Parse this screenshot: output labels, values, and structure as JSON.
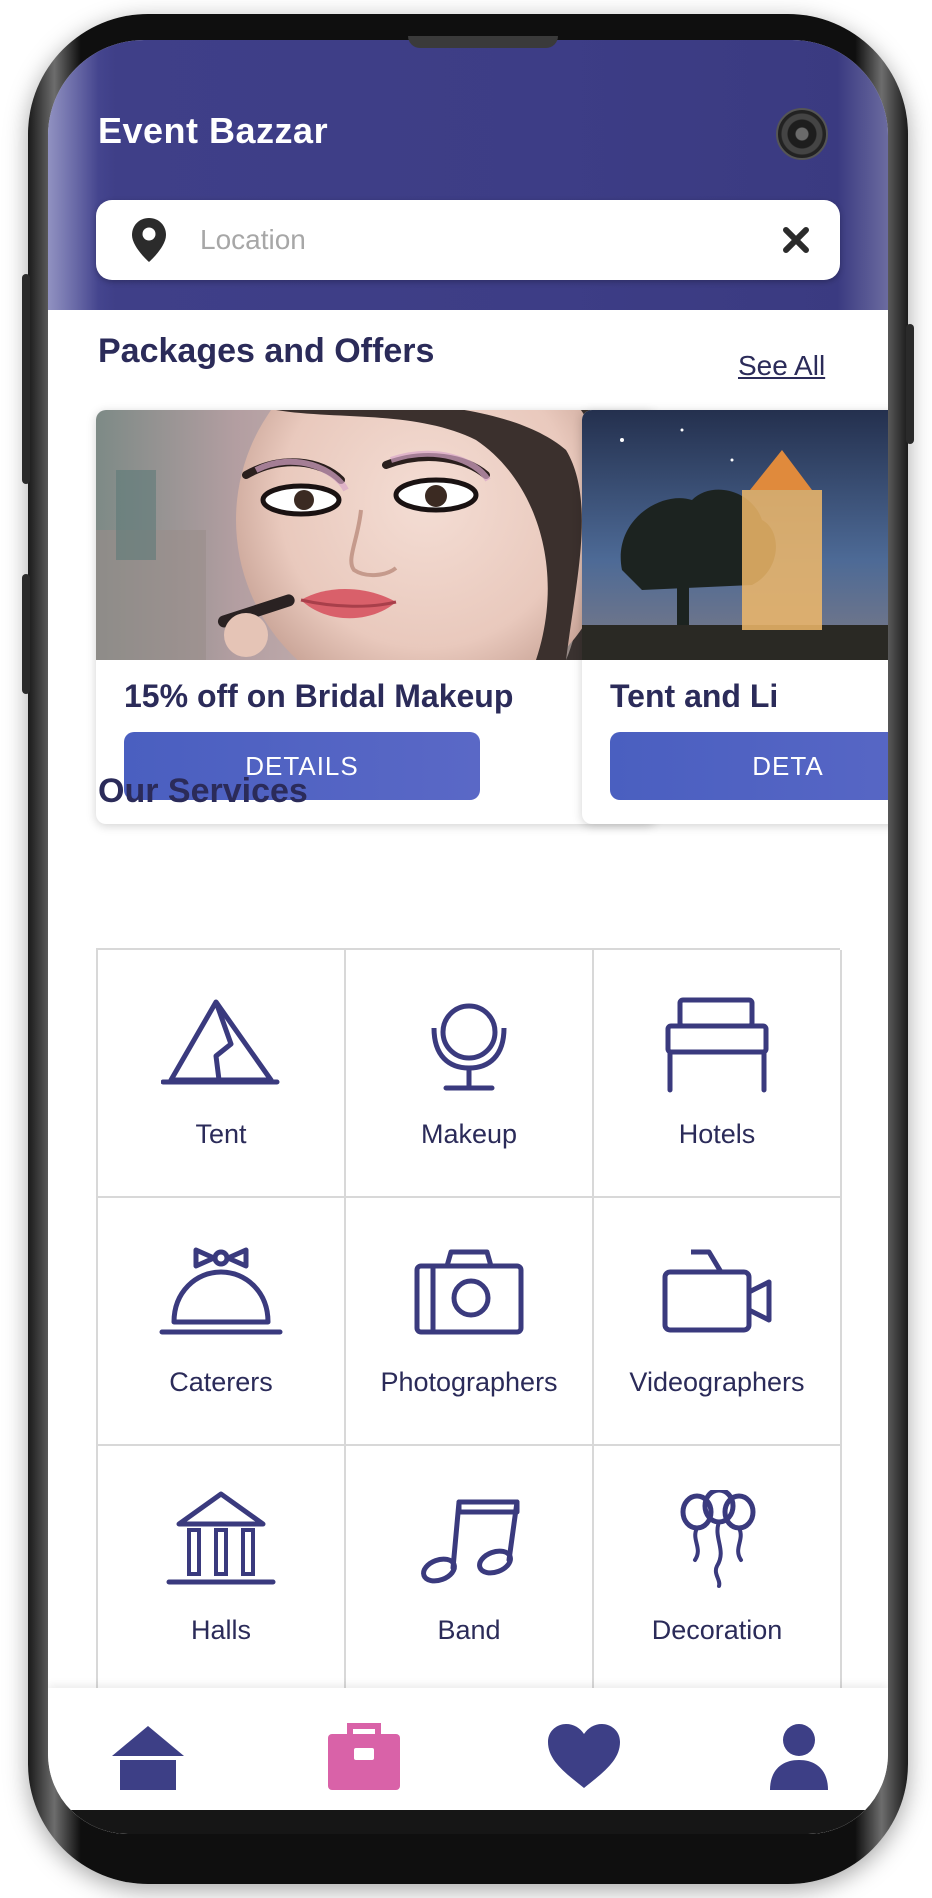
{
  "app": {
    "title": "Event Bazzar"
  },
  "search": {
    "placeholder": "Location",
    "value": ""
  },
  "packages": {
    "title": "Packages and Offers",
    "see_all_label": "See All",
    "cards": [
      {
        "title": "15% off on Bridal Makeup",
        "button_label": "DETAILS"
      },
      {
        "title": "Tent and Li",
        "button_label": "DETA"
      }
    ]
  },
  "services": {
    "title": "Our Services",
    "items": [
      {
        "label": "Tent",
        "icon": "tent-icon"
      },
      {
        "label": "Makeup",
        "icon": "mirror-icon"
      },
      {
        "label": "Hotels",
        "icon": "bed-icon"
      },
      {
        "label": "Caterers",
        "icon": "cloche-icon"
      },
      {
        "label": "Photographers",
        "icon": "camera-icon"
      },
      {
        "label": "Videographers",
        "icon": "video-camera-icon"
      },
      {
        "label": "Halls",
        "icon": "hall-icon"
      },
      {
        "label": "Band",
        "icon": "music-note-icon"
      },
      {
        "label": "Decoration",
        "icon": "balloons-icon"
      }
    ]
  },
  "bottom_nav": {
    "items": [
      {
        "icon": "home-icon",
        "active_color": "#3d3f86"
      },
      {
        "icon": "briefcase-icon",
        "active_color": "#d962a8"
      },
      {
        "icon": "heart-icon",
        "active_color": "#3d3f86"
      },
      {
        "icon": "user-icon",
        "active_color": "#3d3f86"
      }
    ]
  },
  "colors": {
    "primary": "#3d3f86",
    "accent": "#d962a8",
    "button": "#4a5fc0",
    "text_dark": "#2b2b59"
  }
}
